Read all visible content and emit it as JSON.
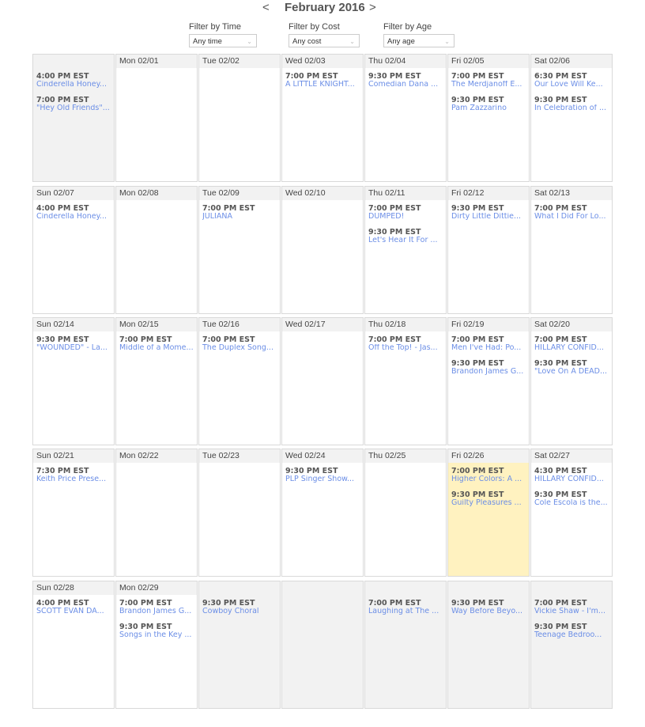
{
  "nav": {
    "prev": "<",
    "title": "February 2016",
    "next": ">"
  },
  "filters": [
    {
      "label": "Filter by Time",
      "value": "Any time"
    },
    {
      "label": "Filter by Cost",
      "value": "Any cost"
    },
    {
      "label": "Filter by Age",
      "value": "Any age"
    }
  ],
  "colors": {
    "event_link": "#6b8ee6",
    "today_bg": "#fff2c0",
    "inactive_bg": "#f2f2f2"
  },
  "weeks": [
    [
      {
        "date": "",
        "inactive": true,
        "events": [
          {
            "time": "4:00 PM EST",
            "name": "Cinderella Honey..."
          },
          {
            "time": "7:00 PM EST",
            "name": "\"Hey Old Friends\"..."
          }
        ]
      },
      {
        "date": "Mon 02/01",
        "events": []
      },
      {
        "date": "Tue 02/02",
        "events": []
      },
      {
        "date": "Wed 02/03",
        "events": [
          {
            "time": "7:00 PM EST",
            "name": "A LITTLE KNIGHT..."
          }
        ]
      },
      {
        "date": "Thu 02/04",
        "events": [
          {
            "time": "9:30 PM EST",
            "name": "Comedian Dana ..."
          }
        ]
      },
      {
        "date": "Fri 02/05",
        "events": [
          {
            "time": "7:00 PM EST",
            "name": "The Merdjanoff E..."
          },
          {
            "time": "9:30 PM EST",
            "name": "Pam Zazzarino"
          }
        ]
      },
      {
        "date": "Sat 02/06",
        "events": [
          {
            "time": "6:30 PM EST",
            "name": "Our Love Will Ke..."
          },
          {
            "time": "9:30 PM EST",
            "name": "In Celebration of ..."
          }
        ]
      }
    ],
    [
      {
        "date": "Sun 02/07",
        "events": [
          {
            "time": "4:00 PM EST",
            "name": "Cinderella Honey..."
          }
        ]
      },
      {
        "date": "Mon 02/08",
        "events": []
      },
      {
        "date": "Tue 02/09",
        "events": [
          {
            "time": "7:00 PM EST",
            "name": "JULIANA"
          }
        ]
      },
      {
        "date": "Wed 02/10",
        "events": []
      },
      {
        "date": "Thu 02/11",
        "events": [
          {
            "time": "7:00 PM EST",
            "name": "DUMPED!"
          },
          {
            "time": "9:30 PM EST",
            "name": "Let's Hear It For ..."
          }
        ]
      },
      {
        "date": "Fri 02/12",
        "events": [
          {
            "time": "9:30 PM EST",
            "name": "Dirty Little Dittie..."
          }
        ]
      },
      {
        "date": "Sat 02/13",
        "events": [
          {
            "time": "7:00 PM EST",
            "name": "What I Did For Lo..."
          }
        ]
      }
    ],
    [
      {
        "date": "Sun 02/14",
        "events": [
          {
            "time": "9:30 PM EST",
            "name": "\"WOUNDED\" - La..."
          }
        ]
      },
      {
        "date": "Mon 02/15",
        "events": [
          {
            "time": "7:00 PM EST",
            "name": "Middle of a Mome..."
          }
        ]
      },
      {
        "date": "Tue 02/16",
        "events": [
          {
            "time": "7:00 PM EST",
            "name": "The Duplex Song..."
          }
        ]
      },
      {
        "date": "Wed 02/17",
        "events": []
      },
      {
        "date": "Thu 02/18",
        "events": [
          {
            "time": "7:00 PM EST",
            "name": "Off the Top! - Jas..."
          }
        ]
      },
      {
        "date": "Fri 02/19",
        "events": [
          {
            "time": "7:00 PM EST",
            "name": "Men I've Had: Po..."
          },
          {
            "time": "9:30 PM EST",
            "name": "Brandon James G..."
          }
        ]
      },
      {
        "date": "Sat 02/20",
        "events": [
          {
            "time": "7:00 PM EST",
            "name": "HILLARY CONFID..."
          },
          {
            "time": "9:30 PM EST",
            "name": "\"Love On A DEAD..."
          }
        ]
      }
    ],
    [
      {
        "date": "Sun 02/21",
        "events": [
          {
            "time": "7:30 PM EST",
            "name": "Keith Price Prese..."
          }
        ]
      },
      {
        "date": "Mon 02/22",
        "events": []
      },
      {
        "date": "Tue 02/23",
        "events": []
      },
      {
        "date": "Wed 02/24",
        "events": [
          {
            "time": "9:30 PM EST",
            "name": "PLP Singer Show..."
          }
        ]
      },
      {
        "date": "Thu 02/25",
        "events": []
      },
      {
        "date": "Fri 02/26",
        "today": true,
        "events": [
          {
            "time": "7:00 PM EST",
            "name": "Higher Colors: A ..."
          },
          {
            "time": "9:30 PM EST",
            "name": "Guilty Pleasures ..."
          }
        ]
      },
      {
        "date": "Sat 02/27",
        "events": [
          {
            "time": "4:30 PM EST",
            "name": "HILLARY CONFID..."
          },
          {
            "time": "9:30 PM EST",
            "name": "Cole Escola is the..."
          }
        ]
      }
    ],
    [
      {
        "date": "Sun 02/28",
        "events": [
          {
            "time": "4:00 PM EST",
            "name": "SCOTT EVAN DA..."
          }
        ]
      },
      {
        "date": "Mon 02/29",
        "events": [
          {
            "time": "7:00 PM EST",
            "name": "Brandon James G..."
          },
          {
            "time": "9:30 PM EST",
            "name": "Songs in the Key ..."
          }
        ]
      },
      {
        "date": "",
        "inactive": true,
        "events": [
          {
            "time": "9:30 PM EST",
            "name": "Cowboy Choral"
          }
        ]
      },
      {
        "date": "",
        "inactive": true,
        "events": []
      },
      {
        "date": "",
        "inactive": true,
        "events": [
          {
            "time": "7:00 PM EST",
            "name": "Laughing at The ..."
          }
        ]
      },
      {
        "date": "",
        "inactive": true,
        "events": [
          {
            "time": "9:30 PM EST",
            "name": "Way Before Beyo..."
          }
        ]
      },
      {
        "date": "",
        "inactive": true,
        "events": [
          {
            "time": "7:00 PM EST",
            "name": "Vickie Shaw - I'm..."
          },
          {
            "time": "9:30 PM EST",
            "name": "Teenage Bedroo..."
          }
        ]
      }
    ]
  ]
}
